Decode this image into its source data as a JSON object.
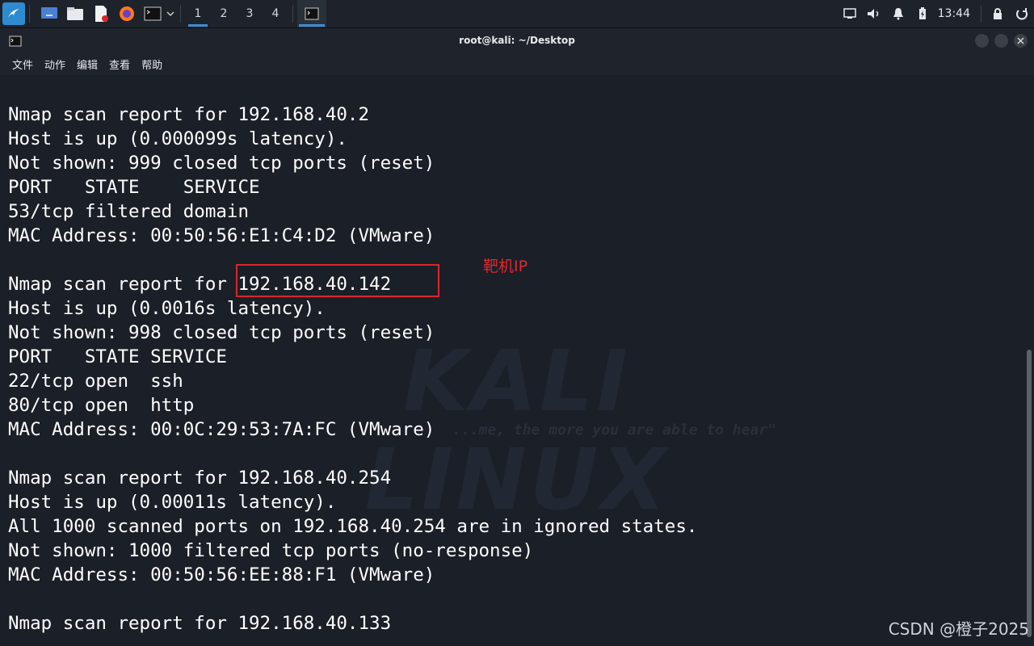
{
  "panel": {
    "workspaces": [
      "1",
      "2",
      "3",
      "4"
    ],
    "active_workspace": "1",
    "clock": "13:44"
  },
  "window": {
    "title": "root@kali: ~/Desktop",
    "menu": [
      "文件",
      "动作",
      "编辑",
      "查看",
      "帮助"
    ]
  },
  "terminal": {
    "lines": [
      "Nmap scan report for 192.168.40.2",
      "Host is up (0.000099s latency).",
      "Not shown: 999 closed tcp ports (reset)",
      "PORT   STATE    SERVICE",
      "53/tcp filtered domain",
      "MAC Address: 00:50:56:E1:C4:D2 (VMware)",
      "",
      "Nmap scan report for 192.168.40.142",
      "Host is up (0.0016s latency).",
      "Not shown: 998 closed tcp ports (reset)",
      "PORT   STATE SERVICE",
      "22/tcp open  ssh",
      "80/tcp open  http",
      "MAC Address: 00:0C:29:53:7A:FC (VMware)",
      "",
      "Nmap scan report for 192.168.40.254",
      "Host is up (0.00011s latency).",
      "All 1000 scanned ports on 192.168.40.254 are in ignored states.",
      "Not shown: 1000 filtered tcp ports (no-response)",
      "MAC Address: 00:50:56:EE:88:F1 (VMware)",
      "",
      "Nmap scan report for 192.168.40.133"
    ]
  },
  "annotation": {
    "label": "靶机IP",
    "color": "#e0282e"
  },
  "wallpaper": {
    "title": "KALI LINUX",
    "quote": "...me, the more you are able to hear\""
  },
  "watermark": "CSDN @橙子2025",
  "colors": {
    "accent": "#3b8fd8",
    "terminal_bg": "#1b1f27",
    "text": "#ffffff"
  }
}
